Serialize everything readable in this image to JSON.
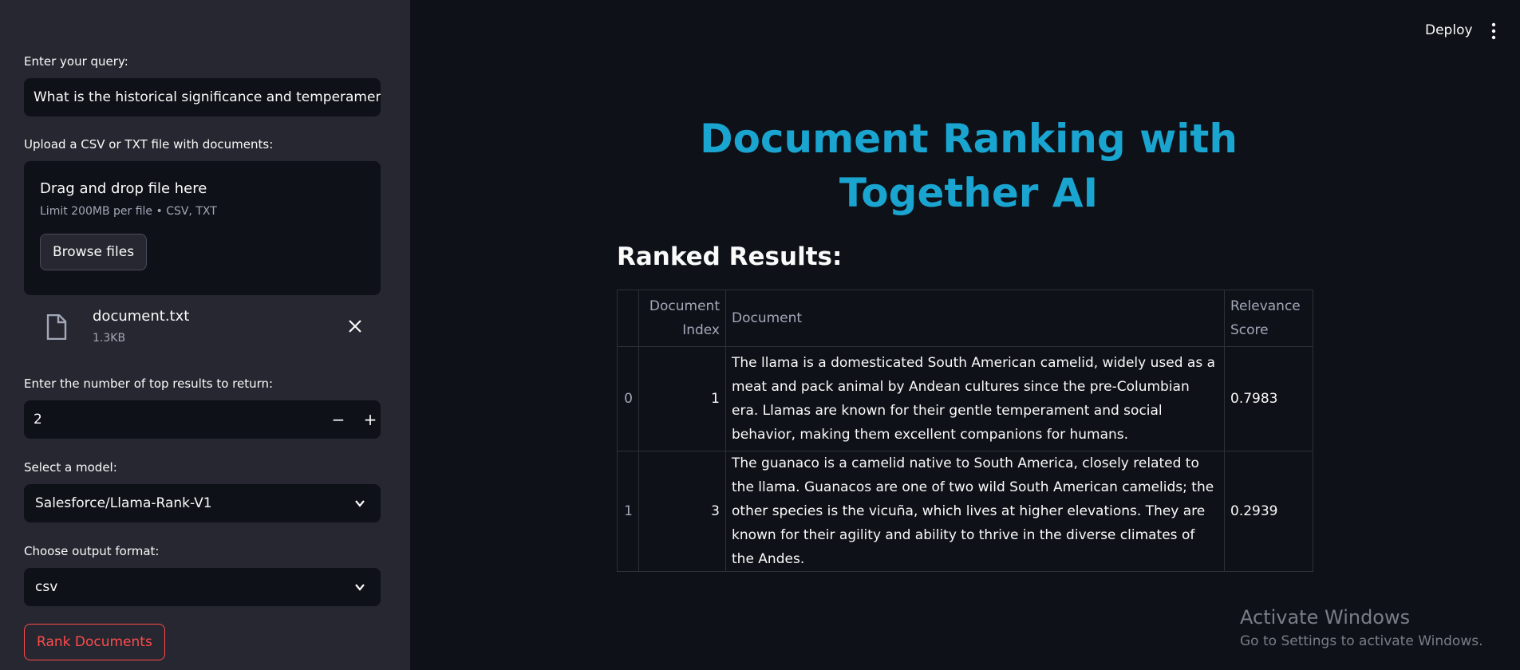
{
  "sidebar": {
    "query_label": "Enter your query:",
    "query_value": "What is the historical significance and temperament of llamas?",
    "upload_label": "Upload a CSV or TXT file with documents:",
    "dropzone_title": "Drag and drop file here",
    "dropzone_limit": "Limit 200MB per file • CSV, TXT",
    "browse_label": "Browse files",
    "file_name": "document.txt",
    "file_size": "1.3KB",
    "topk_label": "Enter the number of top results to return:",
    "topk_value": "2",
    "minus": "−",
    "plus": "+",
    "model_label": "Select a model:",
    "model_value": "Salesforce/Llama-Rank-V1",
    "format_label": "Choose output format:",
    "format_value": "csv",
    "rank_button": "Rank Documents"
  },
  "header": {
    "deploy": "Deploy"
  },
  "main": {
    "title": "Document Ranking with Together AI",
    "subheader": "Ranked Results:",
    "columns": [
      "",
      "Document Index",
      "Document",
      "Relevance Score"
    ],
    "rows": [
      {
        "idx": "0",
        "doc_index": "1",
        "document": "The llama is a domesticated South American camelid, widely used as a meat and pack animal by Andean cultures since the pre-Columbian era. Llamas are known for their gentle temperament and social behavior, making them excellent companions for humans.",
        "score": "0.7983"
      },
      {
        "idx": "1",
        "doc_index": "3",
        "document": "The guanaco is a camelid native to South America, closely related to the llama. Guanacos are one of two wild South American camelids; the other species is the vicuña, which lives at higher elevations. They are known for their agility and ability to thrive in the diverse climates of the Andes.",
        "score": "0.2939"
      }
    ]
  },
  "watermark": {
    "line1": "Activate Windows",
    "line2": "Go to Settings to activate Windows."
  },
  "colors": {
    "accent": "#1aa4d0",
    "primary_red": "#ff4b4b",
    "sidebar_bg": "#262730",
    "main_bg": "#0e1117"
  }
}
